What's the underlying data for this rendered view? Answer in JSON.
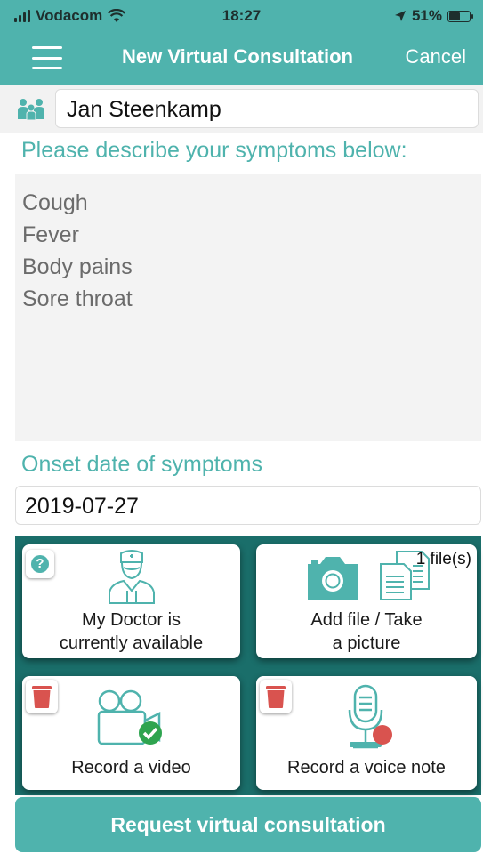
{
  "status_bar": {
    "carrier": "Vodacom",
    "time": "18:27",
    "battery": "51%",
    "battery_level": 0.51
  },
  "header": {
    "title": "New Virtual Consultation",
    "cancel_label": "Cancel",
    "menu_icon": "hamburger-menu-icon"
  },
  "patient": {
    "icon": "family-icon",
    "name": "Jan Steenkamp"
  },
  "symptoms": {
    "label": "Please describe your symptoms below:",
    "lines": [
      "Cough",
      "Fever",
      "Body pains",
      "Sore throat"
    ]
  },
  "onset": {
    "label": "Onset date of symptoms",
    "value": "2019-07-27"
  },
  "actions": {
    "doctor": {
      "line1": "My Doctor is",
      "line2": "currently available",
      "icon": "doctor-icon",
      "badge": "?"
    },
    "file": {
      "line1": "Add file / Take",
      "line2": "a picture",
      "icon": "camera-icon",
      "count": "1 file(s)"
    },
    "video": {
      "label": "Record a video",
      "icon": "video-camera-icon"
    },
    "voice": {
      "label": "Record a voice note",
      "icon": "microphone-icon"
    }
  },
  "request_button": {
    "label": "Request virtual consultation"
  },
  "colors": {
    "primary": "#4fb3ad",
    "grid_bg": "#1a6e6a",
    "danger": "#d9534f",
    "success": "#2ea44f"
  }
}
